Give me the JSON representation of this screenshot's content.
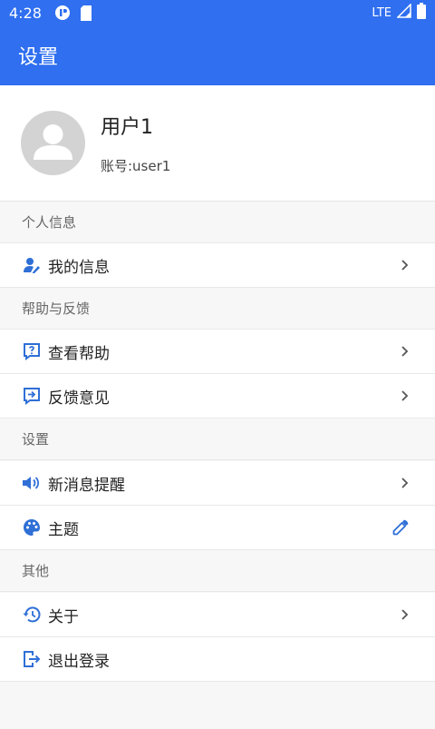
{
  "status_bar": {
    "time": "4:28",
    "network": "LTE"
  },
  "app_bar": {
    "title": "设置"
  },
  "profile": {
    "name": "用户1",
    "account": "账号:user1"
  },
  "sections": [
    {
      "title": "个人信息",
      "items": [
        {
          "label": "我的信息",
          "icon": "user-edit-icon",
          "trail": "chevron-right-icon"
        }
      ]
    },
    {
      "title": "帮助与反馈",
      "items": [
        {
          "label": "查看帮助",
          "icon": "help-question-icon",
          "trail": "chevron-right-icon"
        },
        {
          "label": "反馈意见",
          "icon": "feedback-icon",
          "trail": "chevron-right-icon"
        }
      ]
    },
    {
      "title": "设置",
      "items": [
        {
          "label": "新消息提醒",
          "icon": "speaker-icon",
          "trail": "chevron-right-icon"
        },
        {
          "label": "主题",
          "icon": "palette-icon",
          "trail": "eyedropper-icon"
        }
      ]
    },
    {
      "title": "其他",
      "items": [
        {
          "label": "关于",
          "icon": "history-icon",
          "trail": "chevron-right-icon"
        },
        {
          "label": "退出登录",
          "icon": "logout-icon",
          "trail": ""
        }
      ]
    }
  ],
  "colors": {
    "primary": "#2f6ff0",
    "icon_blue": "#2f6fd6",
    "background": "#f7f7f7"
  }
}
